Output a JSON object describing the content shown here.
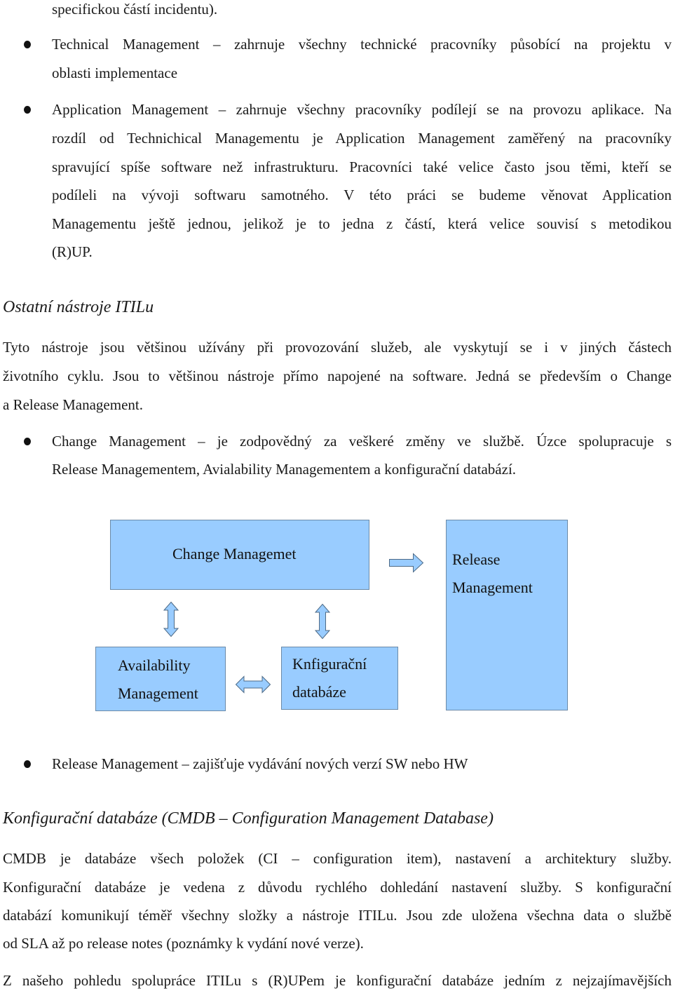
{
  "document": {
    "intro_tail": "specifickou částí incidentu).",
    "bullets_top": [
      {
        "lines": [
          "Technical Management – zahrnuje všechny technické pracovníky působící na projektu v",
          "oblasti implementace"
        ]
      },
      {
        "lines": [
          "Application Management – zahrnuje všechny pracovníky podílejí se na provozu aplikace. Na",
          "rozdíl od Technichical Managementu je Application Management zaměřený na pracovníky",
          "spravující spíše software než infrastrukturu. Pracovníci také velice často jsou těmi, kteří se",
          "podíleli na vývoji softwaru samotného. V této práci  se budeme věnovat Application",
          "Managementu ještě jednou, jelikož je to jedna z částí, která velice souvisí s metodikou",
          "(R)UP."
        ]
      }
    ],
    "section1": {
      "heading": "Ostatní nástroje ITILu",
      "paragraph": [
        "Tyto nástroje jsou většinou užívány při provozování služeb, ale vyskytují se i v jiných částech",
        "životního cyklu. Jsou to většinou nástroje přímo napojené na software. Jedná se především o Change",
        "a Release Management."
      ],
      "bullet_change": [
        "Change Management – je zodpovědný za veškeré změny ve službě. Úzce spolupracuje s",
        "Release Managementem, Avialability Managementem a konfigurační databází."
      ],
      "bullet_release": "Release Management – zajišťuje vydávání nových verzí SW nebo HW"
    },
    "diagram": {
      "fill_color": "#99ccff",
      "nodes": {
        "change": "Change Managemet",
        "release": [
          "Release",
          "Management"
        ],
        "availability": [
          "Availability",
          "Management"
        ],
        "config": [
          "Knfigurační",
          "databáze"
        ]
      },
      "edges": [
        {
          "from": "change",
          "to": "release",
          "type": "right-arrow"
        },
        {
          "from": "change",
          "to": "availability",
          "type": "double-arrow-vertical"
        },
        {
          "from": "change",
          "to": "config",
          "type": "double-arrow-vertical"
        },
        {
          "from": "availability",
          "to": "config",
          "type": "double-arrow-horizontal"
        }
      ]
    },
    "section2": {
      "heading": "Konfigurační databáze (CMDB – Configuration Management Database)",
      "paragraph": [
        "CMDB je databáze všech položek (CI – configuration item), nastavení a architektury služby.",
        "Konfigurační databáze je vedena z důvodu rychlého dohledání nastavení služby. S konfigurační",
        "databází komunikují téměř všechny složky a nástroje ITILu. Jsou zde uložena všechna data o službě",
        "od SLA až po release notes (poznámky k vydání nové verze)."
      ],
      "paragraph2_first_line": "Z našeho pohledu spolupráce ITILu s (R)UPem je konfigurační databáze jedním z nejzajímavějších"
    }
  }
}
